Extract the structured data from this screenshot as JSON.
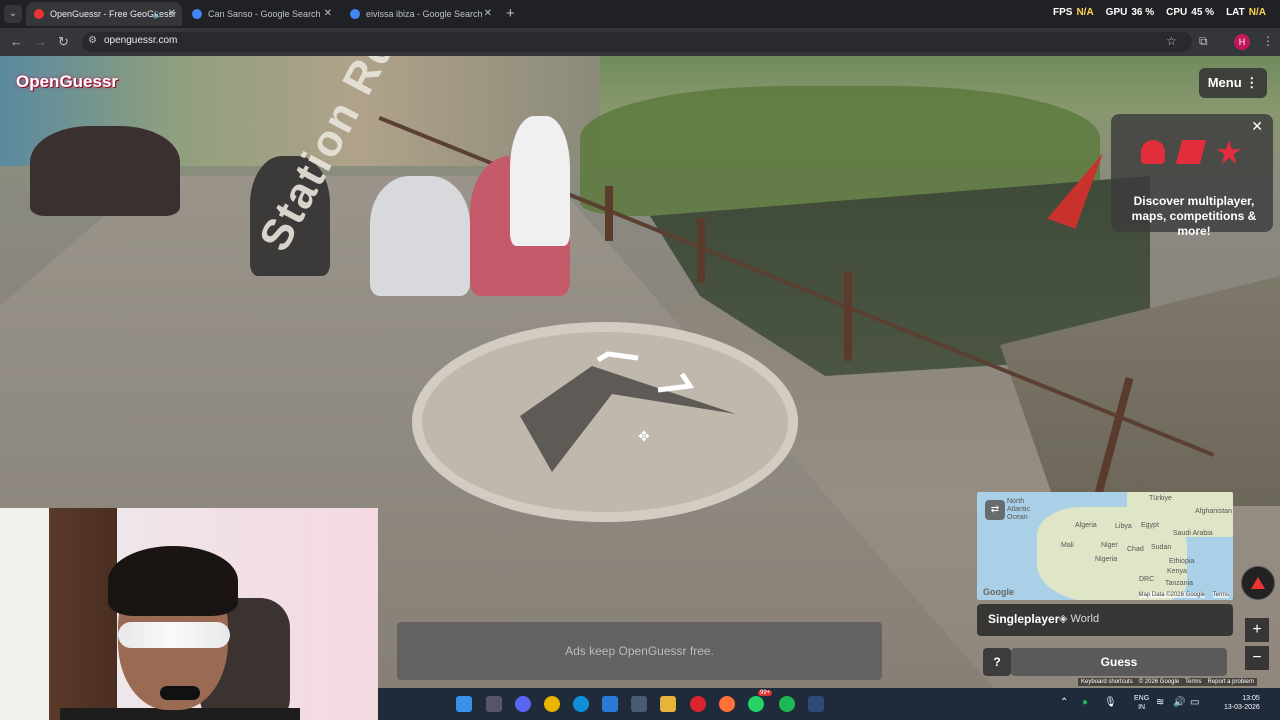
{
  "browser": {
    "tabs": [
      {
        "title": "OpenGuessr - Free GeoGuessr",
        "active": true,
        "muted_icon": "speaker-icon"
      },
      {
        "title": "Can Sanso - Google Search",
        "active": false
      },
      {
        "title": "eivissa ibiza - Google Search",
        "active": false
      }
    ],
    "url": "openguessr.com",
    "profile_initial": "H"
  },
  "perf": {
    "fps_label": "FPS",
    "fps_value": "N/A",
    "gpu_label": "GPU",
    "gpu_value": "36 %",
    "cpu_label": "CPU",
    "cpu_value": "45 %",
    "lat_label": "LAT",
    "lat_value": "N/A"
  },
  "game": {
    "logo": "OpenGuessr",
    "menu_label": "Menu",
    "promo_text": "Discover multiplayer, maps, competitions & more!",
    "road_text": "Station Rd",
    "ads_text": "Ads keep OpenGuessr free.",
    "mode_label": "Singleplayer",
    "map_label": "World",
    "help_label": "?",
    "guess_label": "Guess",
    "zoom_in": "+",
    "zoom_out": "−"
  },
  "minimap": {
    "labels": [
      "North",
      "Atlantic",
      "Ocean",
      "Türkiye",
      "Afghanistan",
      "Algeria",
      "Libya",
      "Egypt",
      "Saudi Arabia",
      "Mali",
      "Niger",
      "Chad",
      "Sudan",
      "Nigeria",
      "Ethiopia",
      "DRC",
      "Kenya",
      "Tanzania"
    ],
    "google": "Google",
    "map_data": "Map Data ©2026 Google",
    "terms": "Terms"
  },
  "google_footer": [
    "Keyboard shortcuts",
    "© 2026 Google",
    "Terms",
    "Report a problem"
  ],
  "taskbar": {
    "lang_top": "ENG",
    "lang_bottom": "IN",
    "time": "13:05",
    "date": "13-03-2026",
    "badge": "99+"
  }
}
